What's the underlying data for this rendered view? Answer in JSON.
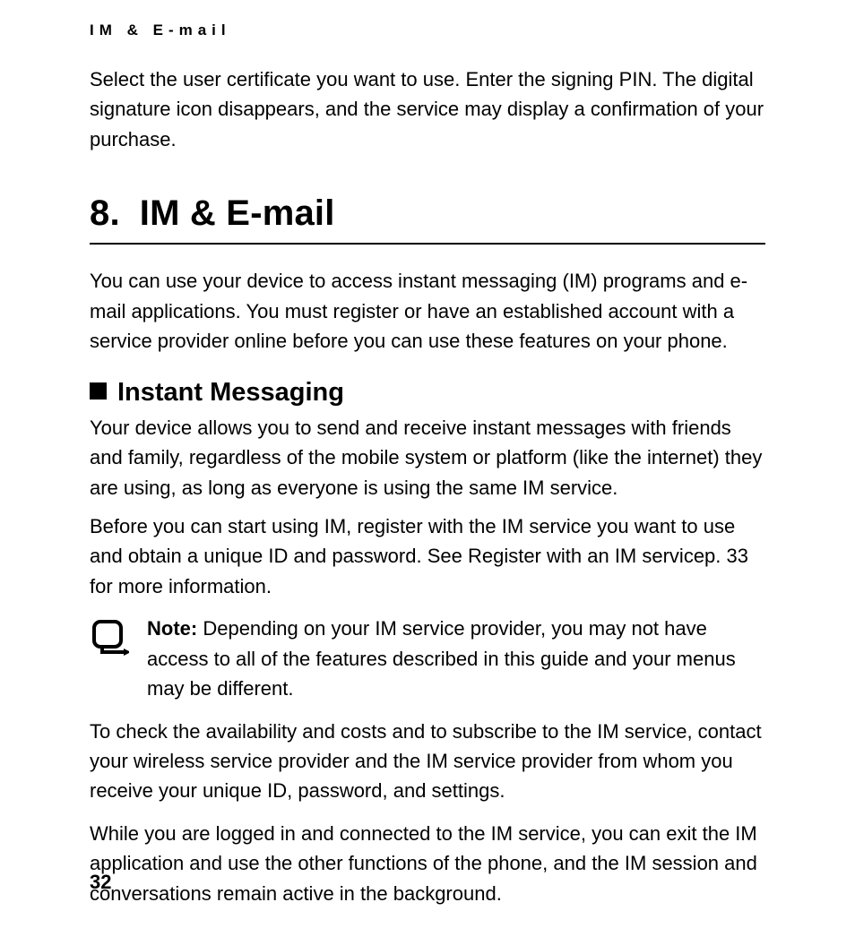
{
  "running_head": "IM & E-mail",
  "intro_para": "Select the user certificate you want to use. Enter the signing PIN. The digital signature icon disappears, and the service may display a confirmation of your purchase.",
  "chapter": {
    "number": "8.",
    "title": "IM & E-mail"
  },
  "chapter_intro": "You can use your device to access instant messaging (IM) programs and e-mail applications. You must register or have an established account with a service provider online before you can use these features on your phone.",
  "section": {
    "title": "Instant Messaging",
    "p1": "Your device allows you to send and receive instant messages with friends and family, regardless of the mobile system or platform (like the internet) they are using, as long as everyone is using the same IM service.",
    "p2": "Before you can start using IM, register with the IM service you want to use and obtain a unique ID and password. See Register with an IM servicep. 33 for more information.",
    "note_label": "Note:",
    "note_body": " Depending on your IM service provider, you may not have access to all of the features described in this guide and your menus may be different.",
    "p3": "To check the availability and costs and to subscribe to the IM service, contact your wireless service provider and the IM service provider from whom you receive your unique ID, password, and settings.",
    "p4": "While you are logged in and connected to the IM service, you can exit the IM application and use the other functions of the phone, and the IM session and conversations remain active in the background."
  },
  "page_number": "32"
}
